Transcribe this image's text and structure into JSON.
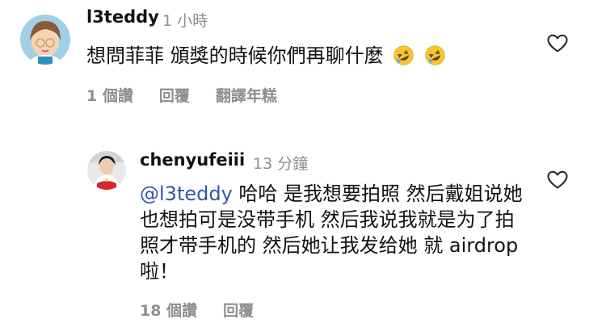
{
  "comments": [
    {
      "username": "l3teddy",
      "time": "1 小時",
      "text": "想問菲菲 頒獎的時候你們再聊什麼",
      "emojis": [
        "rofl-emoji",
        "rofl-emoji"
      ],
      "actions": {
        "likes": "1 個讚",
        "reply": "回覆",
        "translate": "翻譯年糕"
      }
    },
    {
      "username": "chenyufeiii",
      "time": "13 分鐘",
      "mention": "@l3teddy",
      "text": " 哈哈 是我想要拍照 然后戴姐说她也想拍可是没带手机 然后我说我就是为了拍照才带手机的 然后她让我发给她 就 airdrop 啦！",
      "actions": {
        "likes": "18 個讚",
        "reply": "回覆"
      }
    }
  ],
  "icons": {
    "like": "heart-outline-icon"
  },
  "colors": {
    "mention": "#2f57a8",
    "meta": "#8e8e8e",
    "text": "#111111"
  }
}
